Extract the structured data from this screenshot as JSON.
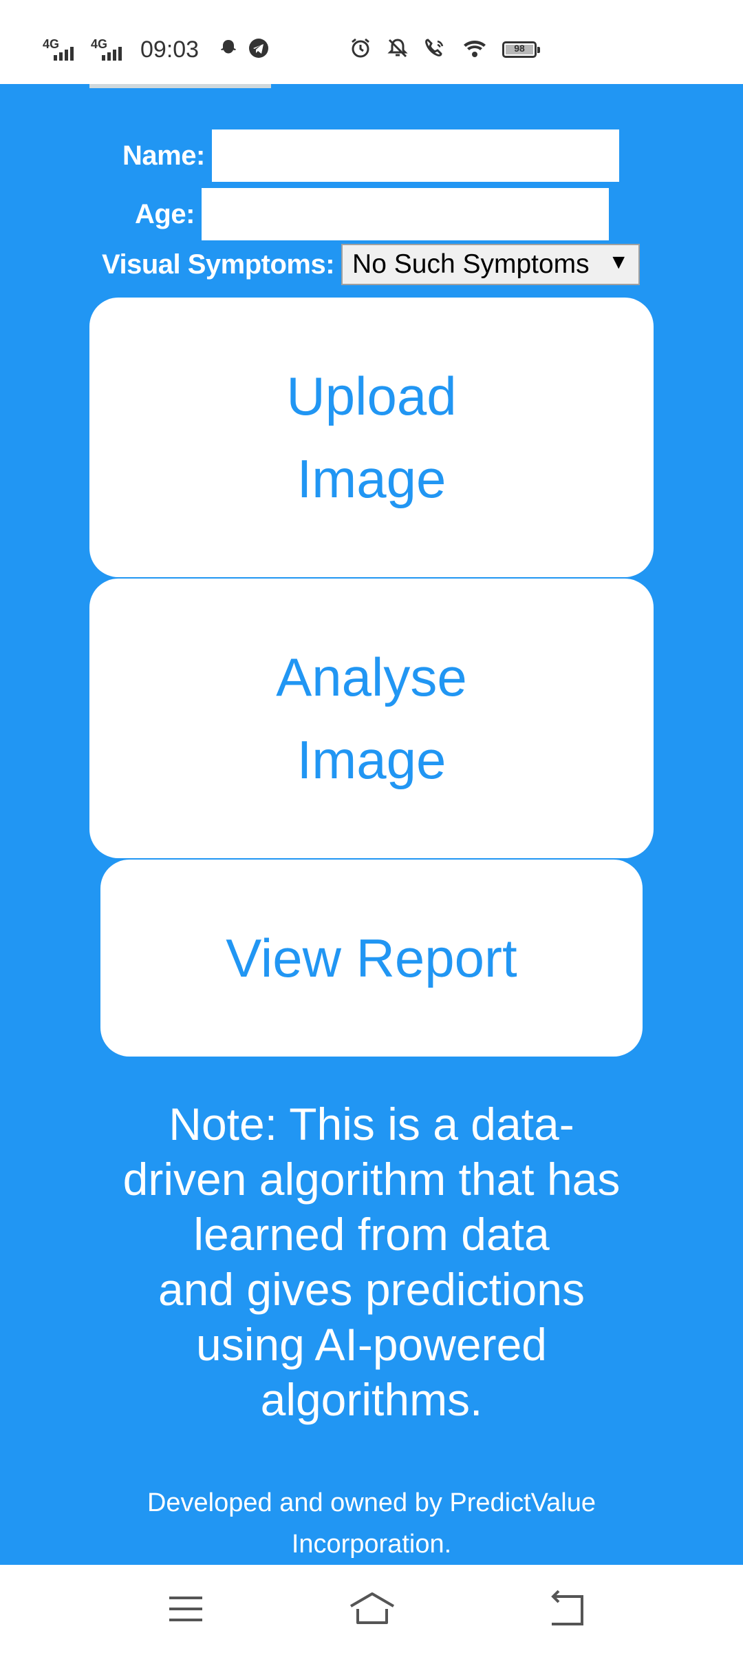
{
  "status_bar": {
    "network_1": "4G",
    "network_2": "4G",
    "time": "09:03",
    "battery_percent": "98",
    "icons_left": [
      "signal-icon",
      "signal-icon",
      "snapchat-icon",
      "telegram-icon"
    ],
    "icons_right": [
      "alarm-icon",
      "notifications-off-icon",
      "wifi-calling-icon",
      "wifi-icon",
      "battery-icon"
    ]
  },
  "form": {
    "name_label": "Name:",
    "name_value": "",
    "age_label": "Age:",
    "age_value": "",
    "symptoms_label": "Visual Symptoms:",
    "symptoms_selected": "No Such Symptoms",
    "symptoms_caret": "▼"
  },
  "buttons": {
    "upload_line1": "Upload",
    "upload_line2": "Image",
    "analyse_line1": "Analyse",
    "analyse_line2": "Image",
    "view_report": "View Report"
  },
  "note": {
    "line1": "Note: This is a data-",
    "line2": "driven algorithm that has",
    "line3": "learned from data",
    "line4": "and gives predictions",
    "line5": "using AI-powered",
    "line6": "algorithms."
  },
  "footer": {
    "line1": "Developed and owned by PredictValue",
    "line2": "Incorporation."
  },
  "nav": {
    "icons": [
      "menu-icon",
      "home-icon",
      "back-icon"
    ]
  },
  "colors": {
    "primary": "#2196f3",
    "card": "#ffffff",
    "text_on_primary": "#ffffff"
  }
}
